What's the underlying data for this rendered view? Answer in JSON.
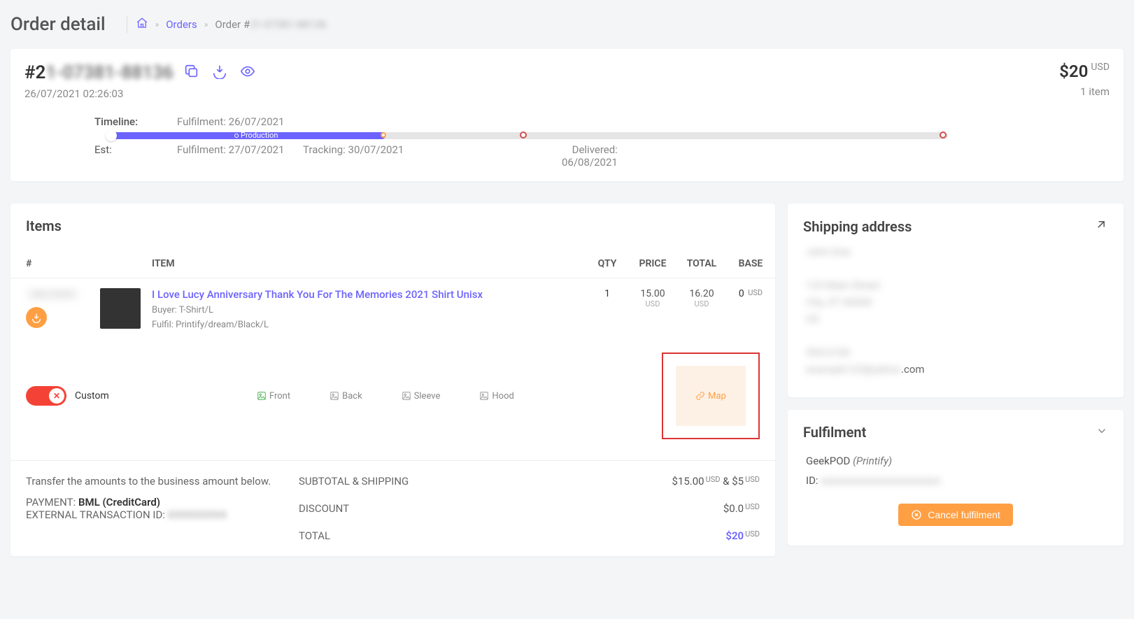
{
  "page_title": "Order detail",
  "breadcrumb": {
    "orders_label": "Orders",
    "current_prefix": "Order #",
    "current_id": "21-07381-88136"
  },
  "order": {
    "number_prefix": "#2",
    "number_hidden": "1-07381-88136",
    "date": "26/07/2021 02:26:03",
    "total_amount": "$20",
    "currency": "USD",
    "item_count": "1 item"
  },
  "timeline": {
    "label": "Timeline:",
    "fulfilment_top": "Fulfilment: 26/07/2021",
    "progress_label": "Production",
    "est_label": "Est:",
    "est_fulfilment": "Fulfilment: 27/07/2021",
    "est_tracking": "Tracking: 30/07/2021",
    "est_delivered_label": "Delivered:",
    "est_delivered_date": "06/08/2021"
  },
  "items_section": {
    "title": "Items",
    "headers": {
      "num": "#",
      "item": "ITEM",
      "qty": "QTY",
      "price": "PRICE",
      "total": "TOTAL",
      "base": "BASE"
    },
    "rows": [
      {
        "sku_hidden": "SKU-XXXX",
        "title": "I Love Lucy Anniversary Thank You For The Memories 2021 Shirt Unisx",
        "buyer_label": "Buyer: ",
        "buyer_value": "T-Shirt/L",
        "fulfil_label": "Fulfil: ",
        "fulfil_value": "Printify/dream/Black/L",
        "qty": "1",
        "price_val": "15.00",
        "price_cur": "USD",
        "total_val": "16.20",
        "total_cur": "USD",
        "base_val": "0",
        "base_cur": "USD"
      }
    ],
    "toggle_label": "Custom",
    "designs": {
      "front": "Front",
      "back": "Back",
      "sleeve": "Sleeve",
      "hood": "Hood",
      "map": "Map"
    }
  },
  "totals": {
    "transfer_note": "Transfer the amounts to the business amount below.",
    "subtotal_label": "SUBTOTAL & SHIPPING",
    "subtotal_value_a": "$15.00",
    "subtotal_value_b": "$5",
    "usd": "USD",
    "amp": " & ",
    "payment_label": "PAYMENT: ",
    "payment_value": "BML (CreditCard)",
    "ext_label": "EXTERNAL TRANSACTION ID: ",
    "ext_value_hidden": "XXXXXXXXX",
    "discount_label": "DISCOUNT",
    "discount_value": "$0.0",
    "total_label": "TOTAL",
    "total_value": "$20"
  },
  "shipping": {
    "title": "Shipping address",
    "name_hidden": "John Doe",
    "line1_hidden": "123 Main Street",
    "line2_hidden": "City, ST 00000",
    "line3_hidden": "US",
    "phone_hidden": "555-0100",
    "email_hidden_prefix": "example123@yahoo",
    "email_suffix": ".com"
  },
  "fulfilment": {
    "title": "Fulfilment",
    "provider": "GeekPOD ",
    "provider_sub": "(Printify)",
    "id_label": "ID: ",
    "id_hidden": "xxxxxxxxxxxxxxxxxxxxxxx",
    "cancel_label": "Cancel fulfilment"
  }
}
